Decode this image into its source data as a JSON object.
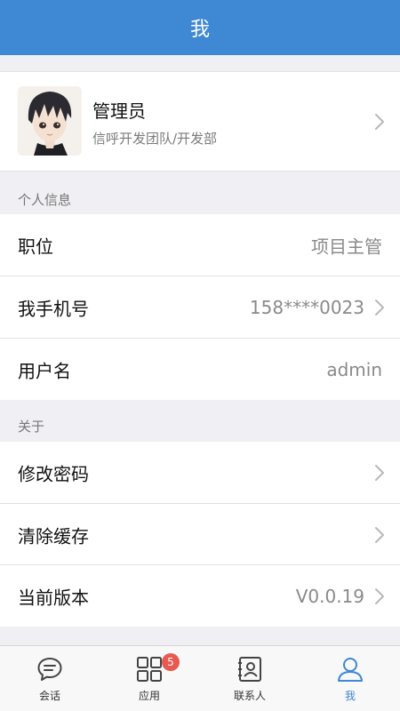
{
  "header": {
    "title": "我"
  },
  "profile": {
    "name": "管理员",
    "team": "信呼开发团队/开发部"
  },
  "sections": {
    "personal": "个人信息",
    "about": "关于"
  },
  "rows": {
    "position": {
      "label": "职位",
      "value": "项目主管"
    },
    "phone": {
      "label": "我手机号",
      "value": "158****0023"
    },
    "username": {
      "label": "用户名",
      "value": "admin"
    },
    "change_password": {
      "label": "修改密码"
    },
    "clear_cache": {
      "label": "清除缓存"
    },
    "version": {
      "label": "当前版本",
      "value": "V0.0.19"
    }
  },
  "tabbar": {
    "items": [
      {
        "label": "会话",
        "icon": "chat-icon"
      },
      {
        "label": "应用",
        "icon": "apps-grid-icon",
        "badge": "5"
      },
      {
        "label": "联系人",
        "icon": "contacts-icon"
      },
      {
        "label": "我",
        "icon": "user-icon",
        "active": true
      }
    ]
  },
  "colors": {
    "accent": "#3f88d4",
    "badge": "#e85a4f",
    "background": "#efeff4"
  }
}
